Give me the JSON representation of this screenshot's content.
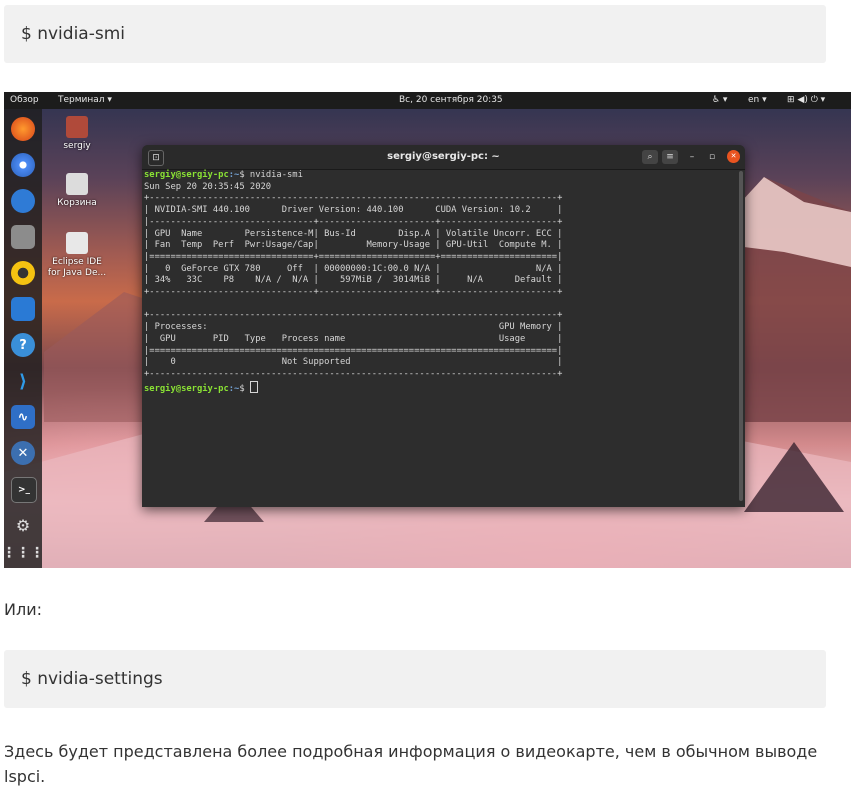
{
  "commands": {
    "first": "$ nvidia-smi",
    "second": "$  nvidia-settings"
  },
  "text": {
    "or": "Или:",
    "description": "Здесь будет представлена более подробная информация о видеокарте, чем в обычном выводе lspci."
  },
  "topbar": {
    "activities": "Обзор",
    "app_menu": "Терминал ▾",
    "clock": "Вс, 20 сентября  20:35",
    "accessibility": "♿ ▾",
    "language": "en ▾",
    "status": "⊞  ◀)  ⏻ ▾"
  },
  "desktop": {
    "home_label": "sergiy",
    "trash_label": "Корзина",
    "eclipse_label_1": "Eclipse IDE",
    "eclipse_label_2": "for Java De..."
  },
  "terminal": {
    "title": "sergiy@sergiy-pc: ~",
    "search_btn": "⌕",
    "menu_btn": "≡",
    "minimize_btn": "–",
    "maximize_btn": "▫",
    "close_btn": "✕",
    "prompt_user": "sergiy@sergiy-pc",
    "prompt_path": ":~",
    "command": "$ nvidia-smi",
    "output": "Sun Sep 20 20:35:45 2020\n+-----------------------------------------------------------------------------+\n| NVIDIA-SMI 440.100      Driver Version: 440.100      CUDA Version: 10.2     |\n|-------------------------------+----------------------+----------------------+\n| GPU  Name        Persistence-M| Bus-Id        Disp.A | Volatile Uncorr. ECC |\n| Fan  Temp  Perf  Pwr:Usage/Cap|         Memory-Usage | GPU-Util  Compute M. |\n|===============================+======================+======================|\n|   0  GeForce GTX 780     Off  | 00000000:1C:00.0 N/A |                  N/A |\n| 34%   33C    P8    N/A /  N/A |    597MiB /  3014MiB |     N/A      Default |\n+-------------------------------+----------------------+----------------------+\n\n+-----------------------------------------------------------------------------+\n| Processes:                                                       GPU Memory |\n|  GPU       PID   Type   Process name                             Usage      |\n|=============================================================================|\n|    0                    Not Supported                                       |\n+-----------------------------------------------------------------------------+",
    "final_prompt_cmd": "$ "
  }
}
